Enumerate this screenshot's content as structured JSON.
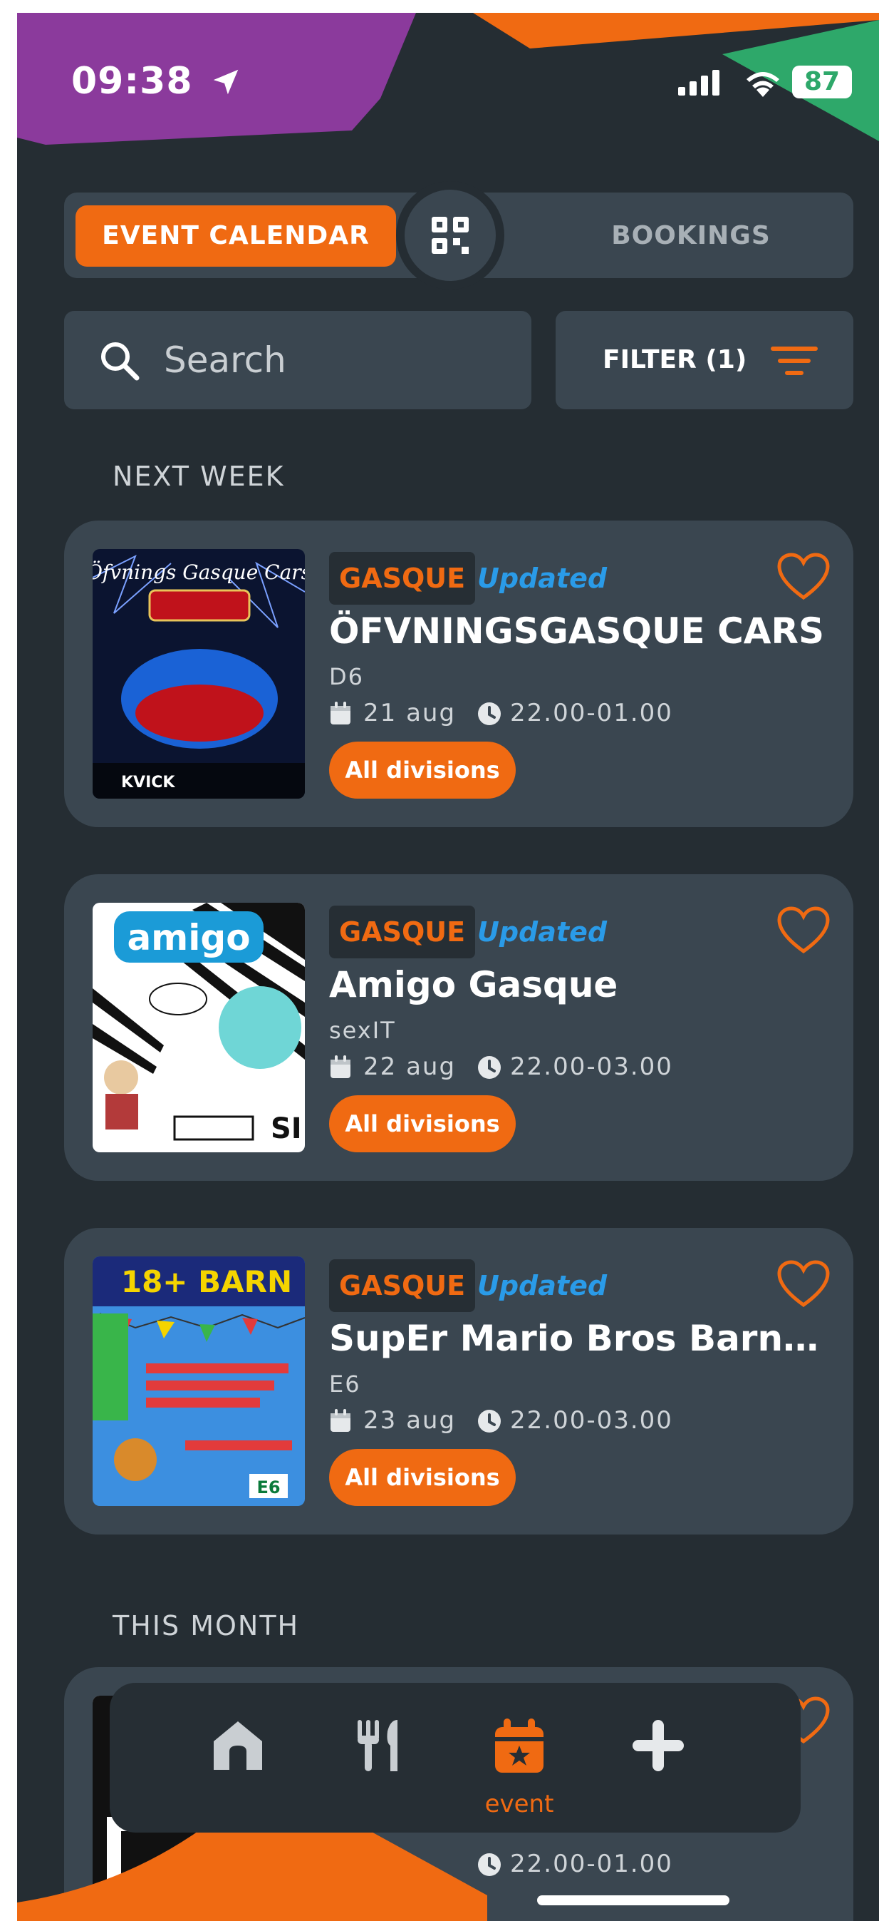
{
  "status_bar": {
    "time": "09:38",
    "battery": "87"
  },
  "tabs": {
    "event_calendar": "EVENT CALENDAR",
    "bookings": "BOOKINGS"
  },
  "search": {
    "placeholder": "Search"
  },
  "filter": {
    "label": "FILTER (1)"
  },
  "sections": {
    "next_week": "NEXT WEEK",
    "this_month": "THIS MONTH"
  },
  "events": [
    {
      "tag": "GASQUE",
      "status": "Updated",
      "title": "ÖFVNINGSGASQUE CARS",
      "venue": "D6",
      "date": "21 aug",
      "time": "22.00-01.00",
      "badge": "All divisions",
      "thumb": "Öfvnings Gasque Cars"
    },
    {
      "tag": "GASQUE",
      "status": "Updated",
      "title": "Amigo Gasque",
      "venue": "sexIT",
      "date": "22 aug",
      "time": "22.00-03.00",
      "badge": "All divisions",
      "thumb": "amigo"
    },
    {
      "tag": "GASQUE",
      "status": "Updated",
      "title": "SupEr Mario Bros Barnk...",
      "venue": "E6",
      "date": "23 aug",
      "time": "22.00-03.00",
      "badge": "All divisions",
      "thumb": "18+ BARN"
    }
  ],
  "partial_event": {
    "time": "22.00-01.00"
  },
  "nav": {
    "event_label": "event"
  },
  "colors": {
    "accent": "#f06a12",
    "background": "#252d33",
    "card": "#3a4650",
    "updated": "#2a9be8",
    "purple": "#8b3a9c",
    "green": "#2ea86a"
  },
  "icons": [
    "location-arrow-icon",
    "signal-icon",
    "wifi-icon",
    "qr-code-icon",
    "search-icon",
    "filter-icon",
    "heart-icon",
    "calendar-icon",
    "clock-icon",
    "home-icon",
    "cutlery-icon",
    "event-calendar-icon",
    "plus-icon"
  ]
}
